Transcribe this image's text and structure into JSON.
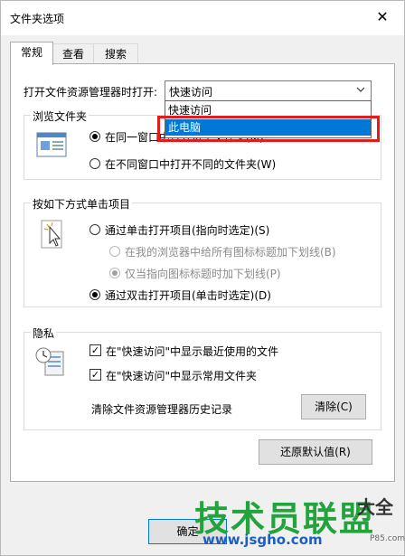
{
  "window": {
    "title": "文件夹选项",
    "close_glyph": "✕"
  },
  "tabs": [
    "常规",
    "查看",
    "搜索"
  ],
  "open_explorer": {
    "label": "打开文件资源管理器时打开:",
    "selected": "快速访问",
    "options": [
      "快速访问",
      "此电脑"
    ],
    "highlighted": "此电脑"
  },
  "browse_folders": {
    "title": "浏览文件夹",
    "option_same": "在同一窗口中打开每个文件夹(M)",
    "option_diff": "在不同窗口中打开不同的文件夹(W)"
  },
  "click_items": {
    "title": "按如下方式单击项目",
    "single_click": "通过单击打开项目(指向时选定)(S)",
    "underline_all": "在我的浏览器中给所有图标标题加下划线(B)",
    "underline_hover": "仅当指向图标标题时加下划线(P)",
    "double_click": "通过双击打开项目(单击时选定)(D)"
  },
  "privacy": {
    "title": "隐私",
    "recent_files": "在\"快速访问\"中显示最近使用的文件",
    "frequent_folders": "在\"快速访问\"中显示常用文件夹",
    "clear_history_label": "清除文件资源管理器历史记录",
    "clear_button": "清除(C)"
  },
  "restore_defaults_button": "还原默认值(R)",
  "ok_button": "确定",
  "watermark": {
    "brand": "技术员联盟",
    "url": "www.jsgho.com",
    "extra": "大全",
    "extra_url": "P85.com"
  },
  "colors": {
    "accent": "#0078d7",
    "highlight_border": "#e41b1b",
    "watermark_green": "#22a33c",
    "watermark_blue": "#1d5fc1"
  }
}
